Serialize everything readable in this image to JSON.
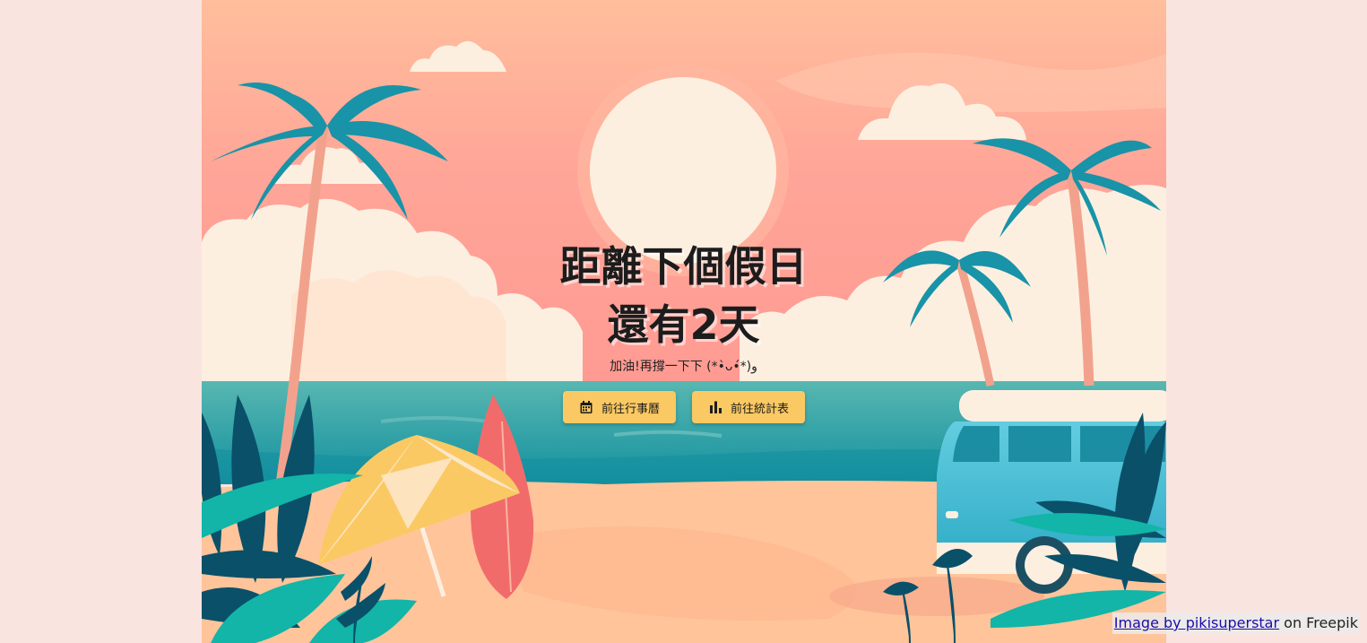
{
  "hero": {
    "title_line1": "距離下個假日",
    "title_line2": "還有2天",
    "subtitle": "加油!再撐一下下 (*•̀ᴗ•́*)و"
  },
  "buttons": {
    "calendar_label": "前往行事曆",
    "calendar_icon": "calendar-icon",
    "stats_label": "前往統計表",
    "stats_icon": "bar-chart-icon"
  },
  "credit": {
    "link_text": "Image by pikisuperstar",
    "suffix": "on Freepik"
  },
  "colors": {
    "page_background": "#f9e4df",
    "button": "#fbc963",
    "sky_top": "#ffbf9e",
    "sea": "#2ea3a6",
    "sand": "#ffc49a"
  }
}
